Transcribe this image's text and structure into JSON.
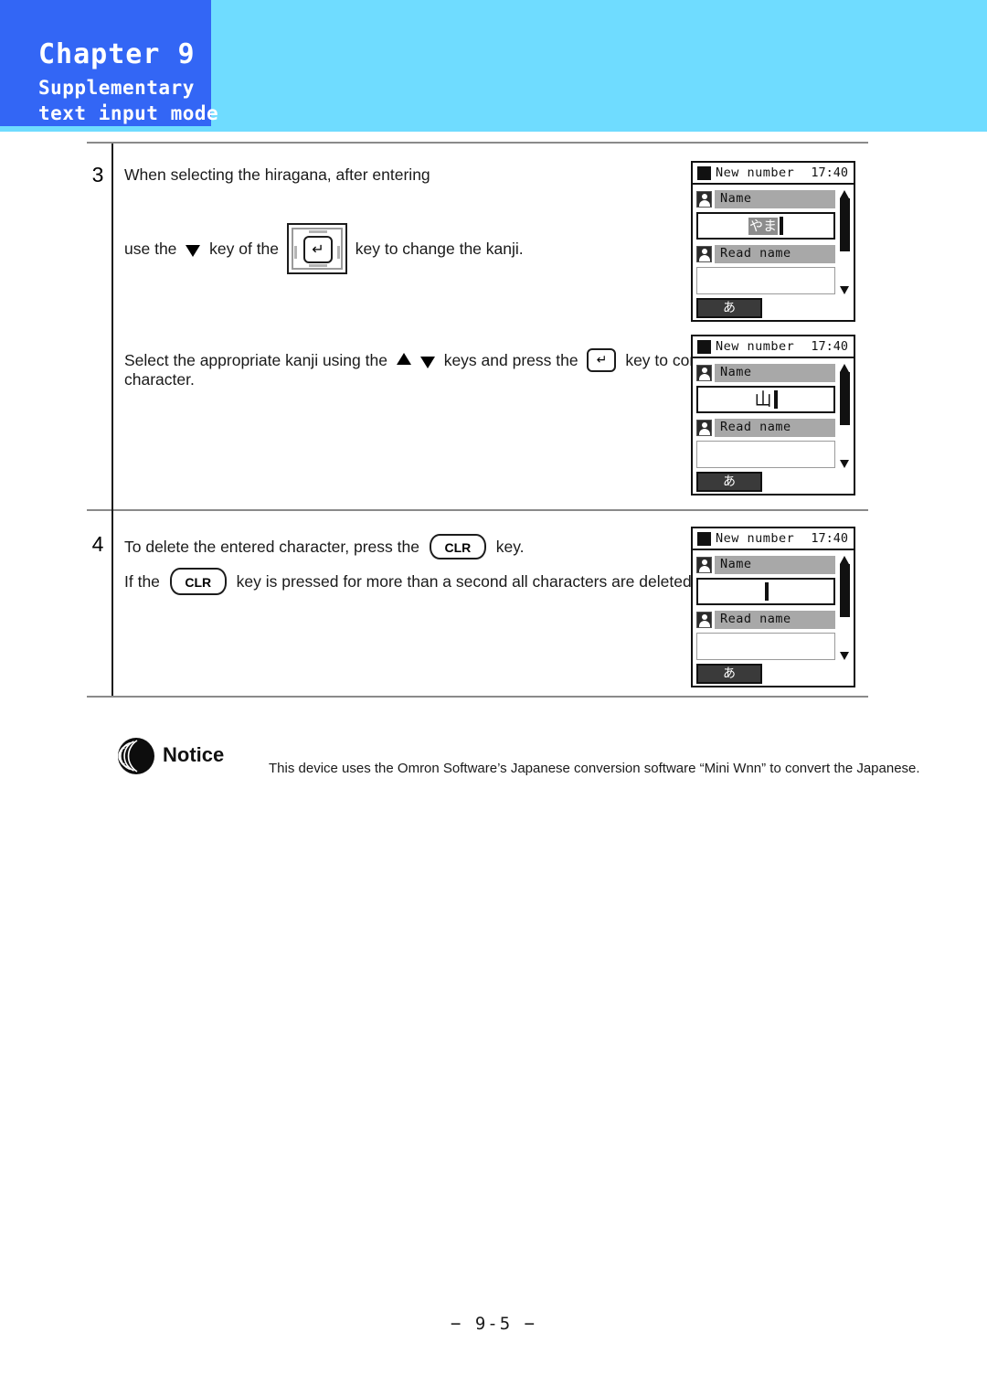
{
  "header": {
    "chapter_title": "Chapter 9",
    "subtitle_line1": "Supplementary",
    "subtitle_line2": "text input mode",
    "block_color": "#3366f5",
    "band_color": "#6fdcff"
  },
  "steps": [
    {
      "number": "3",
      "line1": "When selecting the hiragana, after entering",
      "line2_pre": "use the ",
      "line2_mid": " key of the ",
      "line2_post": " key to change the kanji.",
      "line3_pre": "Select the appropriate kanji using the ",
      "line3_mid": " keys and press the ",
      "line3_post": " key to confirm the",
      "line4": "character."
    },
    {
      "number": "4",
      "line1_pre": "To delete the entered character, press the ",
      "line1_post": " key.",
      "line2_pre": "If the ",
      "line2_post": " key is pressed for more than a second all characters are deleted."
    }
  ],
  "keys": {
    "clr_label": "CLR",
    "enter_glyph": "↵"
  },
  "screens": [
    {
      "title": "New number",
      "time": "17:40",
      "name_label": "Name",
      "name_value": "やま",
      "name_value_style": "highlighted",
      "read_name_label": "Read name",
      "read_name_value": "",
      "mode_indicator": "あ"
    },
    {
      "title": "New number",
      "time": "17:40",
      "name_label": "Name",
      "name_value": "山",
      "name_value_style": "plain",
      "read_name_label": "Read name",
      "read_name_value": "",
      "mode_indicator": "あ"
    },
    {
      "title": "New number",
      "time": "17:40",
      "name_label": "Name",
      "name_value": "",
      "name_value_style": "empty",
      "read_name_label": "Read name",
      "read_name_value": "",
      "mode_indicator": "あ"
    }
  ],
  "notice": {
    "label": "Notice",
    "text": "This device uses the Omron Software’s Japanese conversion software “Mini Wnn” to convert the Japanese."
  },
  "footer": {
    "page_number": "− 9-5 −"
  }
}
